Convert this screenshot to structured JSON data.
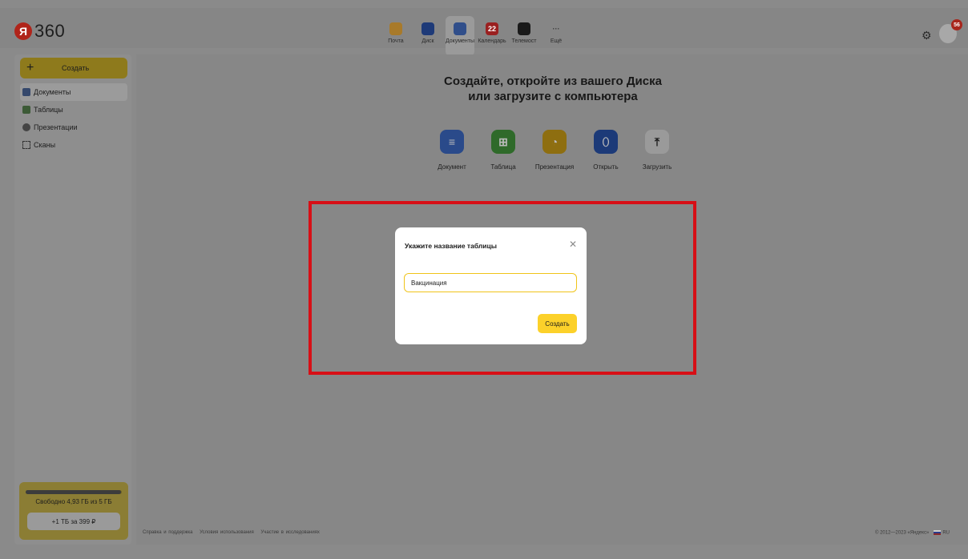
{
  "header": {
    "logo_letter": "Я",
    "logo_text": "360",
    "services": [
      {
        "label": "Почта",
        "icon": "mail-icon",
        "color": "#a87a2a",
        "glyph": "",
        "active": false
      },
      {
        "label": "Диск",
        "icon": "disk-icon",
        "color": "#1e3a78",
        "glyph": "",
        "active": false
      },
      {
        "label": "Документы",
        "icon": "documents-icon",
        "color": "#304e8a",
        "glyph": "",
        "active": true
      },
      {
        "label": "Календарь",
        "icon": "calendar-icon",
        "color": "#9a2020",
        "glyph": "22",
        "active": false
      },
      {
        "label": "Телемост",
        "icon": "telemost-icon",
        "color": "#1a1a1a",
        "glyph": "",
        "active": false
      },
      {
        "label": "Ещё",
        "icon": "more-icon",
        "color": "transparent",
        "glyph": "···",
        "active": false
      }
    ],
    "avatar_badge": "56"
  },
  "sidebar": {
    "create_label": "Создать",
    "items": [
      {
        "label": "Документы",
        "icon": "document-icon",
        "active": true
      },
      {
        "label": "Таблицы",
        "icon": "table-icon",
        "active": false
      },
      {
        "label": "Презентации",
        "icon": "presentation-icon",
        "active": false
      },
      {
        "label": "Сканы",
        "icon": "scan-icon",
        "active": false
      }
    ],
    "storage_text": "Свободно 4,93 ГБ из 5 ГБ",
    "storage_used_fraction": 0.99,
    "upgrade_label": "+1 ТБ за 399 ₽"
  },
  "main": {
    "heading_line1": "Создайте, откройте из вашего Диска",
    "heading_line2": "или загрузите с компьютера",
    "actions": [
      {
        "label": "Документ",
        "icon": "new-document-icon",
        "color": "#2a4a8a"
      },
      {
        "label": "Таблица",
        "icon": "new-table-icon",
        "color": "#2f6a2a"
      },
      {
        "label": "Презентация",
        "icon": "new-presentation-icon",
        "color": "#8e6e10"
      },
      {
        "label": "Открыть",
        "icon": "open-disk-icon",
        "color": "#1c3a78"
      },
      {
        "label": "Загрузить",
        "icon": "upload-icon",
        "color": "#9a9a9a"
      }
    ]
  },
  "footer": {
    "links": [
      "Справка и поддержка",
      "Условия использования",
      "Участие в исследованиях"
    ],
    "copyright": "© 2012—2023 «Яндекс»",
    "lang": "RU"
  },
  "modal": {
    "title": "Укажите название таблицы",
    "input_value": "Вакцинация",
    "create_label": "Создать",
    "close_icon": "close-icon"
  },
  "colors": {
    "accent": "#fcd12a",
    "highlight": "#d70f16"
  }
}
